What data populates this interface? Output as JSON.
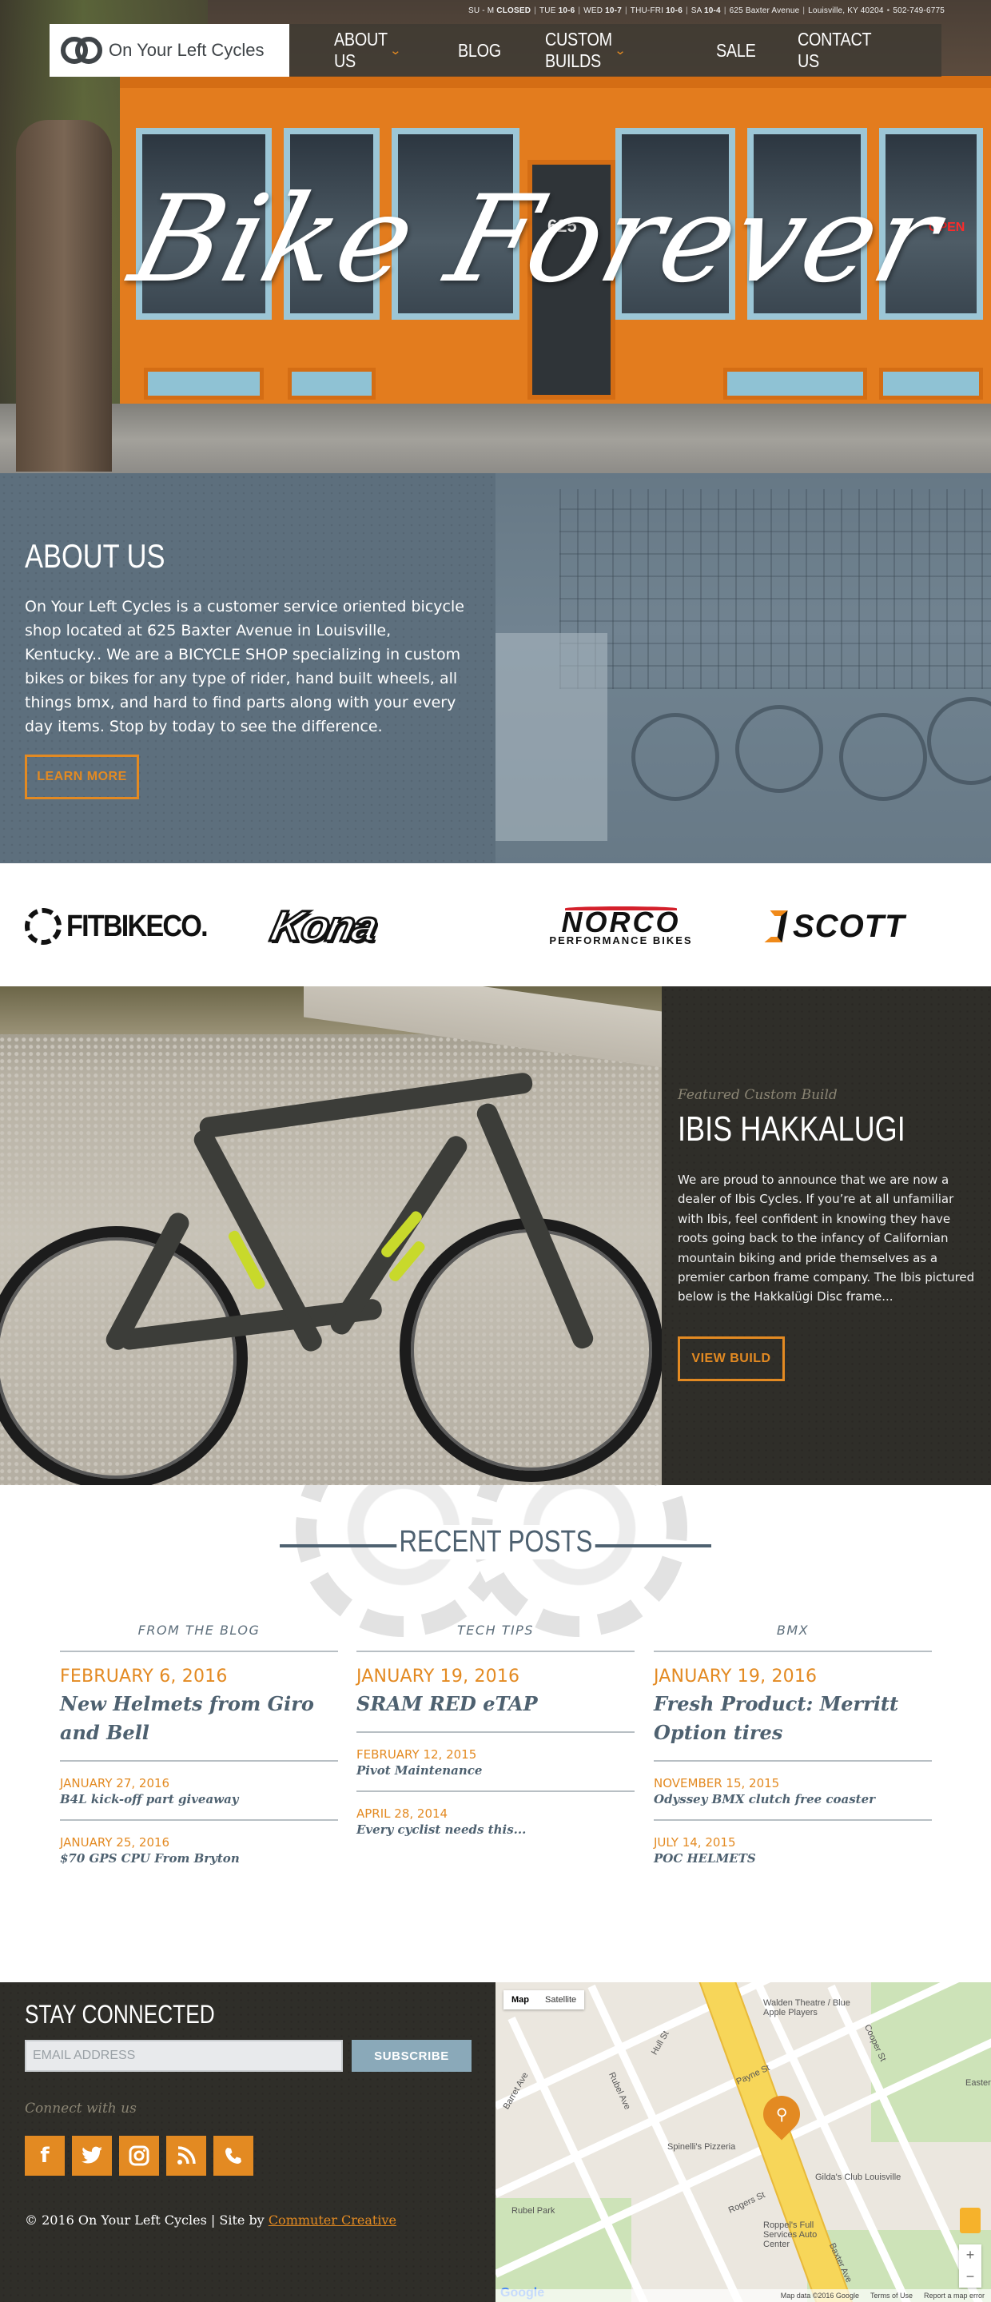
{
  "header": {
    "hours": [
      {
        "day": "SU - M",
        "time": "CLOSED"
      },
      {
        "day": "TUE",
        "time": "10-6"
      },
      {
        "day": "WED",
        "time": "10-7"
      },
      {
        "day": "THU-FRI",
        "time": "10-6"
      },
      {
        "day": "SA",
        "time": "10-4"
      }
    ],
    "address": "625 Baxter Avenue",
    "city": "Louisville, KY 40204",
    "phone": "502-749-6775",
    "logo_text": "On Your Left Cycles",
    "nav": [
      {
        "label": "About Us",
        "dropdown": true
      },
      {
        "label": "Blog",
        "dropdown": false
      },
      {
        "label": "Custom Builds",
        "dropdown": true
      },
      {
        "label": "Sale",
        "dropdown": false
      },
      {
        "label": "Contact Us",
        "dropdown": false
      }
    ]
  },
  "hero": {
    "title": "Bike Forever",
    "door_number": "625",
    "open_sign": "OPEN"
  },
  "about": {
    "heading": "ABOUT US",
    "body": "On Your Left Cycles is a customer service oriented bicycle shop located at 625 Baxter Avenue in Louisville, Kentucky.. We are a BICYCLE SHOP specializing in custom bikes or bikes for any type of rider, hand built wheels, all things bmx, and hard to find parts along with your every day items. Stop by today to see the difference.",
    "button": "LEARN MORE"
  },
  "brands": [
    {
      "name": "FITBIKECO."
    },
    {
      "name": "Kona"
    },
    {
      "name": "NORCO",
      "sub": "PERFORMANCE BIKES"
    },
    {
      "name": "SCOTT"
    }
  ],
  "featured": {
    "eyebrow": "Featured Custom Build",
    "title": "IBIS HAKKALUGI",
    "body": "We are proud to announce that we are now a dealer of Ibis Cycles. If you’re at all unfamiliar with Ibis, feel confident in knowing they have roots going back to the infancy of Californian mountain biking and pride themselves as a premier carbon frame company. The Ibis pictured below is the Hakkalügi Disc frame...",
    "button": "VIEW BUILD"
  },
  "recent": {
    "heading": "RECENT POSTS",
    "columns": [
      {
        "category": "FROM THE BLOG",
        "lead": {
          "date": "FEBRUARY 6, 2016",
          "title": "New Helmets from Giro and Bell"
        },
        "posts": [
          {
            "date": "JANUARY 27, 2016",
            "title": "B4L kick-off part giveaway"
          },
          {
            "date": "JANUARY 25, 2016",
            "title": "$70 GPS CPU From Bryton"
          }
        ]
      },
      {
        "category": "TECH TIPS",
        "lead": {
          "date": "JANUARY 19, 2016",
          "title": "SRAM RED eTAP"
        },
        "posts": [
          {
            "date": "FEBRUARY 12, 2015",
            "title": "Pivot Maintenance"
          },
          {
            "date": "APRIL 28, 2014",
            "title": "Every cyclist needs this..."
          }
        ]
      },
      {
        "category": "BMX",
        "lead": {
          "date": "JANUARY 19, 2016",
          "title": "Fresh Product: Merritt Option tires"
        },
        "posts": [
          {
            "date": "NOVEMBER 15, 2015",
            "title": "Odyssey BMX clutch free coaster"
          },
          {
            "date": "JULY 14, 2015",
            "title": "POC HELMETS"
          }
        ]
      }
    ]
  },
  "footer": {
    "heading": "STAY CONNECTED",
    "email_placeholder": "EMAIL ADDRESS",
    "subscribe": "SUBSCRIBE",
    "connect": "Connect with us",
    "social": [
      "f",
      "t",
      "o",
      "rss",
      "phone"
    ],
    "copyright": "© 2016 On Your Left Cycles | Site by ",
    "credit": "Commuter Creative"
  },
  "map": {
    "tab_map": "Map",
    "tab_satellite": "Satellite",
    "labels": [
      "Walden Theatre / Blue Apple Players",
      "Spinelli's Pizzeria",
      "Gilda's Club Louisville",
      "Roppel's Full Services Auto Center",
      "Rubel Park",
      "Payne St",
      "Hull St",
      "Rubel Ave",
      "Rogers St",
      "Baxter Ave",
      "Barret Ave",
      "Cooper St",
      "Eastern"
    ],
    "footer": [
      "Map data ©2016 Google",
      "Terms of Use",
      "Report a map error"
    ],
    "google": "Google"
  },
  "colors": {
    "accent": "#e38a22",
    "slate": "#5d6f7d",
    "dark": "#2f2e29",
    "subscribe": "#8aa9b9"
  }
}
